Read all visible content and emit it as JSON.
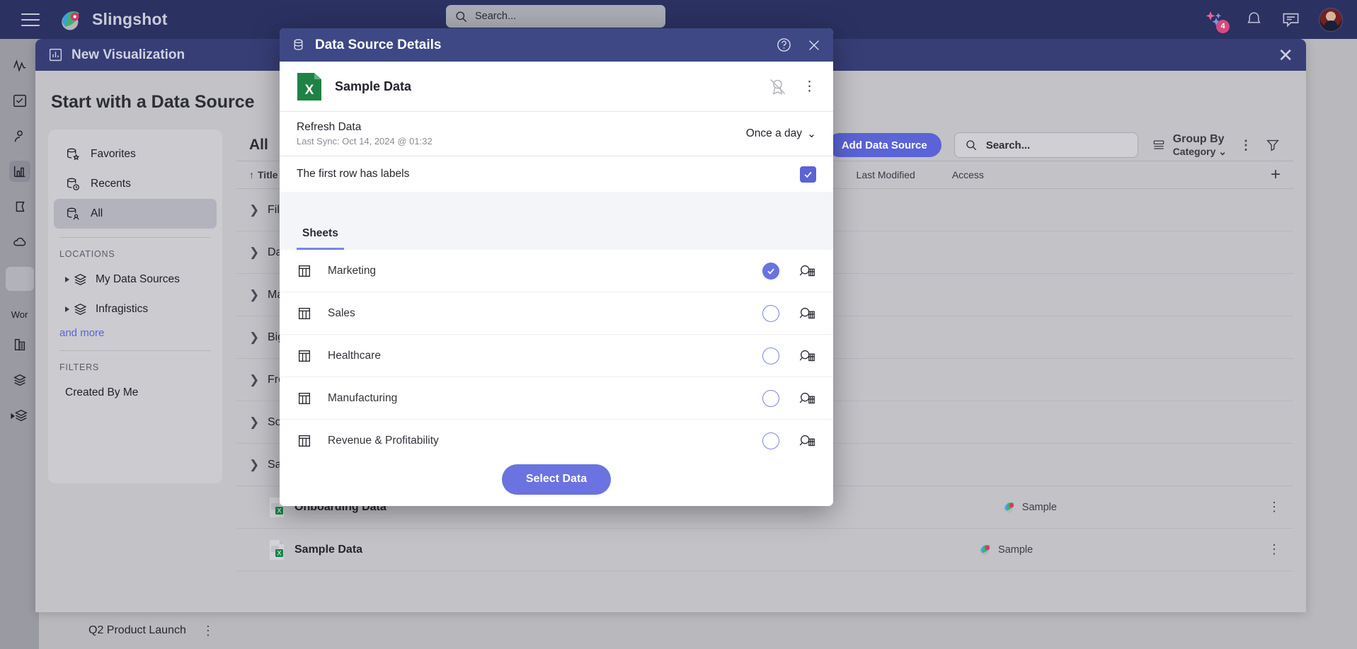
{
  "topbar": {
    "brand": "Slingshot",
    "search_placeholder": "Search...",
    "ai_badge_count": "4",
    "menu_icon": "hamburger-icon",
    "bell_icon": "bell-icon",
    "chat_icon": "chat-icon"
  },
  "viz_panel": {
    "title": "New Visualization",
    "heading": "Start with a Data Source",
    "add_button": "Add Data Source",
    "search_placeholder": "Search...",
    "group_by_label": "Group By",
    "group_by_value": "Category",
    "tab_all": "All",
    "columns": {
      "title": "Title",
      "last_modified": "Last Modified",
      "access": "Access"
    },
    "rows": [
      {
        "label": "Files",
        "expanded": false
      },
      {
        "label": "Databases",
        "expanded": false
      },
      {
        "label": "Marketing",
        "expanded": false
      },
      {
        "label": "Big Data",
        "expanded": false
      },
      {
        "label": "From Apps",
        "expanded": false
      },
      {
        "label": "Social",
        "expanded": false
      },
      {
        "label": "Samples",
        "expanded": true
      }
    ],
    "files": [
      {
        "name": "Onboarding Data",
        "access": "Sample"
      },
      {
        "name": "Sample Data",
        "access": "Sample"
      }
    ],
    "bottom_item": "Q2 Product Launch"
  },
  "sidebar": {
    "items": [
      {
        "label": "Favorites",
        "icon": "database-star-icon",
        "selected": false
      },
      {
        "label": "Recents",
        "icon": "database-clock-icon",
        "selected": false
      },
      {
        "label": "All",
        "icon": "database-person-icon",
        "selected": true
      }
    ],
    "locations_caption": "LOCATIONS",
    "locations": [
      {
        "label": "My Data Sources",
        "icon": "layers-icon"
      },
      {
        "label": "Infragistics",
        "icon": "layers-icon"
      }
    ],
    "and_more": "and more",
    "filters_caption": "FILTERS",
    "filters": [
      {
        "label": "Created By Me"
      }
    ]
  },
  "rail": {
    "workspace_label": "Wor",
    "items": [
      "activity-icon",
      "task-icon",
      "person-icon",
      "chart-icon",
      "bookmark-icon",
      "cloud-icon"
    ]
  },
  "modal": {
    "title": "Data Source Details",
    "title_icon": "database-icon",
    "help_icon": "help-circle-icon",
    "close_icon": "close-icon",
    "file_name": "Sample Data",
    "file_icon": "excel-file-icon",
    "certify_icon": "certification-off-icon",
    "more_icon": "more-vertical-icon",
    "refresh_label": "Refresh Data",
    "last_sync": "Last Sync: Oct 14, 2024 @ 01:32",
    "refresh_frequency": "Once a day",
    "first_row_labels": "The first row has labels",
    "first_row_checked": true,
    "tab_sheets": "Sheets",
    "sheets": [
      {
        "name": "Marketing",
        "selected": true
      },
      {
        "name": "Sales",
        "selected": false
      },
      {
        "name": "Healthcare",
        "selected": false
      },
      {
        "name": "Manufacturing",
        "selected": false
      },
      {
        "name": "Revenue & Profitability",
        "selected": false
      }
    ],
    "select_button": "Select Data"
  },
  "colors": {
    "topbar": "#2b3161",
    "modal_header": "#3e4884",
    "accent": "#6a73e0",
    "excel_green": "#1e8247"
  }
}
